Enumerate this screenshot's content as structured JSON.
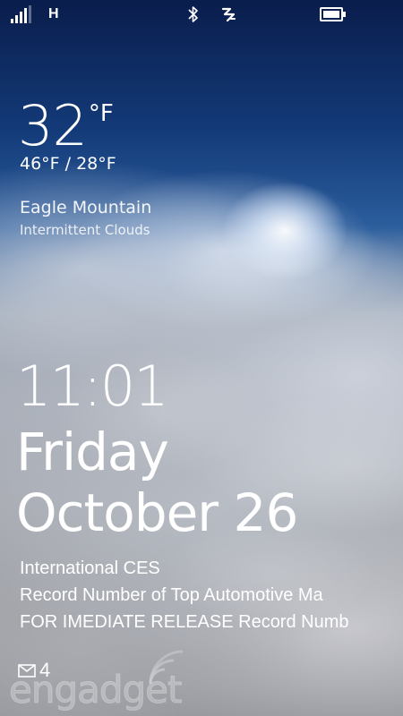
{
  "status_bar": {
    "network_type": "H",
    "icons": [
      "signal-strength-icon",
      "bluetooth-icon",
      "internet-sharing-icon",
      "battery-icon"
    ],
    "signal_bars": 4,
    "battery_level": 0.85
  },
  "weather": {
    "temperature": "32",
    "unit": "°F",
    "high_low": "46°F / 28°F",
    "location": "Eagle Mountain",
    "condition": "Intermittent Clouds"
  },
  "clock": {
    "time": "11:01",
    "day": "Friday",
    "date": "October 26"
  },
  "events": [
    "International CES",
    "Record Number of Top Automotive Ma",
    "FOR IMEDIATE RELEASE Record Numb"
  ],
  "notifications": {
    "mail_icon": "mail-icon",
    "mail_count": "4"
  },
  "watermark": {
    "text": "engadget"
  },
  "colors": {
    "sky_top": "#0a1d4c",
    "text": "#ffffff"
  }
}
